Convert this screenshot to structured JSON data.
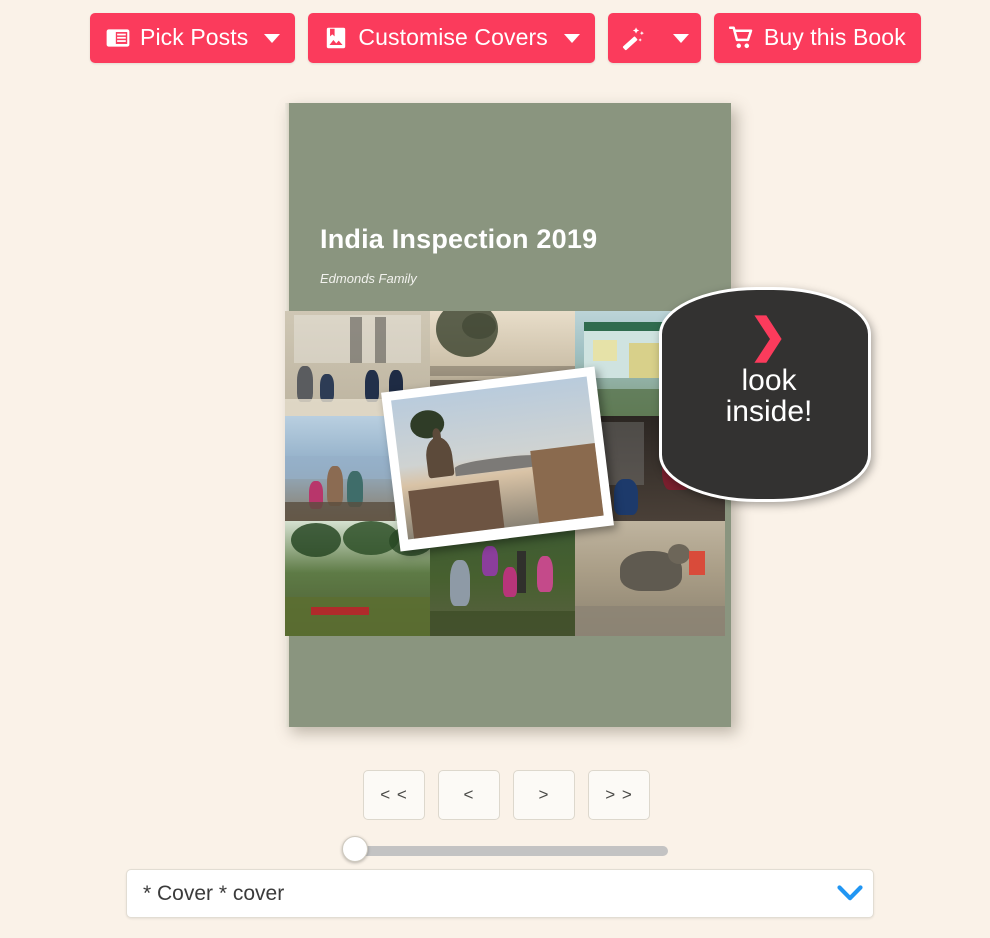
{
  "background_color": "#faf2e8",
  "accent_color": "#fb3b5c",
  "toolbar": {
    "buttons": [
      {
        "id": "pick-posts",
        "label": "Pick Posts",
        "icon": "article-icon",
        "has_caret": true
      },
      {
        "id": "customise-covers",
        "label": "Customise Covers",
        "icon": "image-bookmark-icon",
        "has_caret": true
      },
      {
        "id": "magic",
        "label": "",
        "icon": "magic-wand-icon",
        "has_caret": true
      },
      {
        "id": "buy-this-book",
        "label": "Buy this Book",
        "icon": "shopping-cart-icon",
        "has_caret": false
      }
    ]
  },
  "book": {
    "cover_color": "#8a957f",
    "title": "India Inspection 2019",
    "subtitle": "Edmonds Family",
    "photos": [
      {
        "id": "taj",
        "caption": "children sitting on marble steps at the Taj Mahal"
      },
      {
        "id": "lake",
        "caption": "hazy lake at dusk with bare tree"
      },
      {
        "id": "house",
        "caption": "pale green guesthouse with verandah"
      },
      {
        "id": "city",
        "caption": "family posing above the blue city"
      },
      {
        "id": "steps",
        "caption": "man and boy by a staircase"
      },
      {
        "id": "coast",
        "caption": "rocky coastline under blue sky"
      },
      {
        "id": "backw",
        "caption": "backwaters with palms and a red canoe"
      },
      {
        "id": "kids",
        "caption": "children in a green garden"
      },
      {
        "id": "monk",
        "caption": "monkey carrying a plastic bottle"
      },
      {
        "id": "polaroid",
        "caption": "lake ghat at sunset"
      }
    ]
  },
  "look_inside": {
    "chevron": "❯",
    "line1": "look",
    "line2": "inside!",
    "chevron_color": "#fb3b5c",
    "background_color": "#333231"
  },
  "pager": {
    "buttons": [
      {
        "id": "first",
        "label": "< <"
      },
      {
        "id": "previous",
        "label": "<"
      },
      {
        "id": "next",
        "label": ">"
      },
      {
        "id": "last",
        "label": "> >"
      }
    ]
  },
  "slider": {
    "value": 0,
    "min": 0,
    "max": 100
  },
  "page_select": {
    "value": "* Cover * cover",
    "caret_icon": "chevron-down-icon",
    "caret_color": "#2196f3"
  }
}
